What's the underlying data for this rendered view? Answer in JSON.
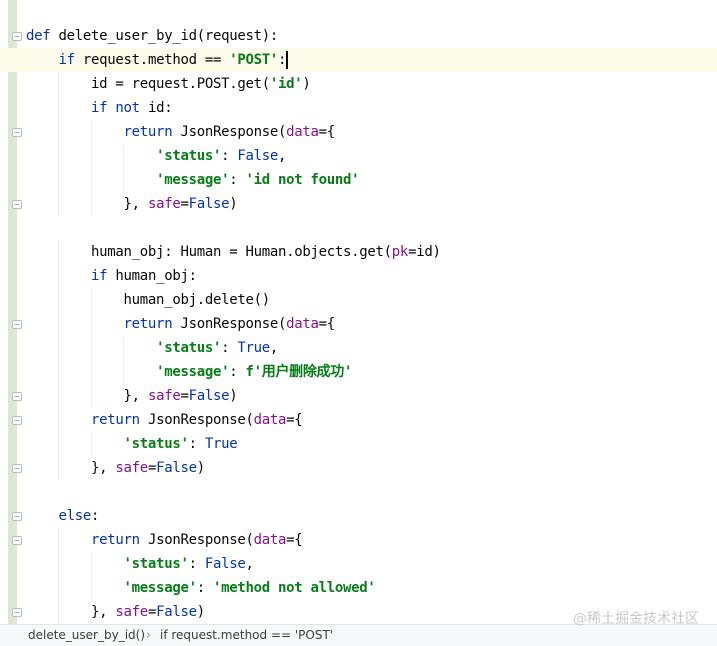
{
  "editor": {
    "lines": [
      [
        {
          "t": "def",
          "c": "kw"
        },
        {
          "t": " delete_user_by_id(request):"
        }
      ],
      [
        {
          "t": "    "
        },
        {
          "t": "if",
          "c": "kw"
        },
        {
          "t": " request.method == "
        },
        {
          "t": "'POST'",
          "c": "str"
        },
        {
          "t": ":"
        }
      ],
      [
        {
          "t": "        id = request.POST.get("
        },
        {
          "t": "'id'",
          "c": "str"
        },
        {
          "t": ")"
        }
      ],
      [
        {
          "t": "        "
        },
        {
          "t": "if not",
          "c": "kw"
        },
        {
          "t": " id:"
        }
      ],
      [
        {
          "t": "            "
        },
        {
          "t": "return",
          "c": "kw"
        },
        {
          "t": " JsonResponse("
        },
        {
          "t": "data",
          "c": "param"
        },
        {
          "t": "={"
        }
      ],
      [
        {
          "t": "                "
        },
        {
          "t": "'status'",
          "c": "str"
        },
        {
          "t": ": "
        },
        {
          "t": "False",
          "c": "const"
        },
        {
          "t": ","
        }
      ],
      [
        {
          "t": "                "
        },
        {
          "t": "'message'",
          "c": "str"
        },
        {
          "t": ": "
        },
        {
          "t": "'id not found'",
          "c": "str"
        }
      ],
      [
        {
          "t": "            }, "
        },
        {
          "t": "safe",
          "c": "param"
        },
        {
          "t": "="
        },
        {
          "t": "False",
          "c": "const"
        },
        {
          "t": ")"
        }
      ],
      [],
      [
        {
          "t": "        human_obj: Human = Human.objects.get("
        },
        {
          "t": "pk",
          "c": "param"
        },
        {
          "t": "=id)"
        }
      ],
      [
        {
          "t": "        "
        },
        {
          "t": "if",
          "c": "kw"
        },
        {
          "t": " human_obj:"
        }
      ],
      [
        {
          "t": "            human_obj.delete()"
        }
      ],
      [
        {
          "t": "            "
        },
        {
          "t": "return",
          "c": "kw"
        },
        {
          "t": " JsonResponse("
        },
        {
          "t": "data",
          "c": "param"
        },
        {
          "t": "={"
        }
      ],
      [
        {
          "t": "                "
        },
        {
          "t": "'status'",
          "c": "str"
        },
        {
          "t": ": "
        },
        {
          "t": "True",
          "c": "const"
        },
        {
          "t": ","
        }
      ],
      [
        {
          "t": "                "
        },
        {
          "t": "'message'",
          "c": "str"
        },
        {
          "t": ": "
        },
        {
          "t": "f'用户删除成功'",
          "c": "str"
        }
      ],
      [
        {
          "t": "            }, "
        },
        {
          "t": "safe",
          "c": "param"
        },
        {
          "t": "="
        },
        {
          "t": "False",
          "c": "const"
        },
        {
          "t": ")"
        }
      ],
      [
        {
          "t": "        "
        },
        {
          "t": "return",
          "c": "kw"
        },
        {
          "t": " JsonResponse("
        },
        {
          "t": "data",
          "c": "param"
        },
        {
          "t": "={"
        }
      ],
      [
        {
          "t": "            "
        },
        {
          "t": "'status'",
          "c": "str"
        },
        {
          "t": ": "
        },
        {
          "t": "True",
          "c": "const"
        }
      ],
      [
        {
          "t": "        }, "
        },
        {
          "t": "safe",
          "c": "param"
        },
        {
          "t": "="
        },
        {
          "t": "False",
          "c": "const"
        },
        {
          "t": ")"
        }
      ],
      [],
      [
        {
          "t": "    "
        },
        {
          "t": "else",
          "c": "kw"
        },
        {
          "t": ":"
        }
      ],
      [
        {
          "t": "        "
        },
        {
          "t": "return",
          "c": "kw"
        },
        {
          "t": " JsonResponse("
        },
        {
          "t": "data",
          "c": "param"
        },
        {
          "t": "={"
        }
      ],
      [
        {
          "t": "            "
        },
        {
          "t": "'status'",
          "c": "str"
        },
        {
          "t": ": "
        },
        {
          "t": "False",
          "c": "const"
        },
        {
          "t": ","
        }
      ],
      [
        {
          "t": "            "
        },
        {
          "t": "'message'",
          "c": "str"
        },
        {
          "t": ": "
        },
        {
          "t": "'method not allowed'",
          "c": "str"
        }
      ],
      [
        {
          "t": "        }, "
        },
        {
          "t": "safe",
          "c": "param"
        },
        {
          "t": "="
        },
        {
          "t": "False",
          "c": "const"
        },
        {
          "t": ")"
        }
      ]
    ]
  },
  "breadcrumb": {
    "items": [
      "delete_user_by_id()",
      "if request.method == 'POST'"
    ],
    "separator": "›"
  },
  "watermark": "@稀土掘金技术社区",
  "colors": {
    "keyword": "#0033b3",
    "string": "#067d17",
    "parameter": "#871094",
    "text": "#080808",
    "current_line": "#fdfbe9",
    "gutter_stripe": "#dce8d2"
  }
}
